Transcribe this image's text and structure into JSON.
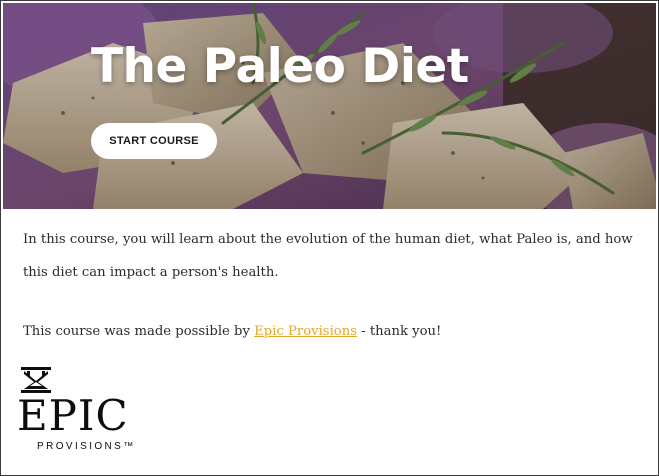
{
  "hero": {
    "title": "The Paleo Diet",
    "start_button_label": "START COURSE",
    "image_icon": "paleo-food-photo"
  },
  "content": {
    "intro_text": "In this course, you will learn about the evolution of the human diet, what Paleo is, and how this diet can impact a person's health.",
    "credit_prefix": "This course was made possible by ",
    "credit_link_text": "Epic Provisions",
    "credit_suffix": " - thank you!"
  },
  "logo": {
    "wordmark": "EPIC",
    "subtitle": "PROVISIONS™",
    "icon": "epic-crest-icon"
  },
  "colors": {
    "link": "#e6a62c",
    "hero_overlay": "#5a3a5e",
    "button_bg": "#ffffff"
  }
}
